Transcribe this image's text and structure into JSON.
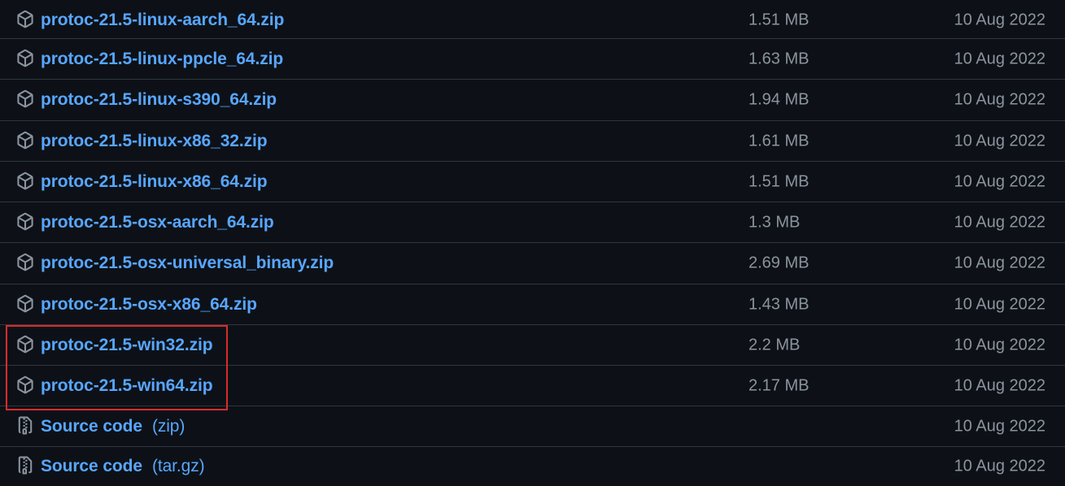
{
  "assets": [
    {
      "name": "protoc-21.5-linux-aarch_64.zip",
      "size": "1.51 MB",
      "date": "10 Aug 2022",
      "icon": "package-icon"
    },
    {
      "name": "protoc-21.5-linux-ppcle_64.zip",
      "size": "1.63 MB",
      "date": "10 Aug 2022",
      "icon": "package-icon"
    },
    {
      "name": "protoc-21.5-linux-s390_64.zip",
      "size": "1.94 MB",
      "date": "10 Aug 2022",
      "icon": "package-icon"
    },
    {
      "name": "protoc-21.5-linux-x86_32.zip",
      "size": "1.61 MB",
      "date": "10 Aug 2022",
      "icon": "package-icon"
    },
    {
      "name": "protoc-21.5-linux-x86_64.zip",
      "size": "1.51 MB",
      "date": "10 Aug 2022",
      "icon": "package-icon"
    },
    {
      "name": "protoc-21.5-osx-aarch_64.zip",
      "size": "1.3 MB",
      "date": "10 Aug 2022",
      "icon": "package-icon"
    },
    {
      "name": "protoc-21.5-osx-universal_binary.zip",
      "size": "2.69 MB",
      "date": "10 Aug 2022",
      "icon": "package-icon"
    },
    {
      "name": "protoc-21.5-osx-x86_64.zip",
      "size": "1.43 MB",
      "date": "10 Aug 2022",
      "icon": "package-icon"
    },
    {
      "name": "protoc-21.5-win32.zip",
      "size": "2.2 MB",
      "date": "10 Aug 2022",
      "icon": "package-icon"
    },
    {
      "name": "protoc-21.5-win64.zip",
      "size": "2.17 MB",
      "date": "10 Aug 2022",
      "icon": "package-icon"
    },
    {
      "name": "Source code",
      "ext": "(zip)",
      "date": "10 Aug 2022",
      "icon": "file-zip-icon"
    },
    {
      "name": "Source code",
      "ext": "(tar.gz)",
      "date": "10 Aug 2022",
      "icon": "file-zip-icon"
    }
  ],
  "colors": {
    "background": "#0d1117",
    "link": "#58a6ff",
    "muted": "#8b949e",
    "border": "#30363d",
    "highlight_box": "#d92b2b"
  }
}
